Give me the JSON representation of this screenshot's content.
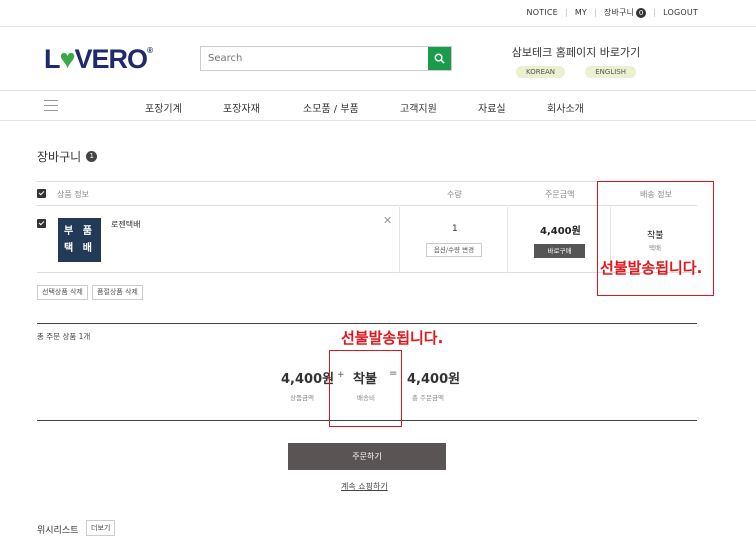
{
  "topbar": {
    "notice": "NOTICE",
    "my": "MY",
    "cart": "장바구니",
    "cart_count": "0",
    "logout": "LOGOUT"
  },
  "header": {
    "logo_l": "L",
    "logo_heart": "♥",
    "logo_rest": "VERO",
    "logo_reg": "®",
    "search_placeholder": "Search",
    "samboh_title": "삼보테크 홈페이지 바로가기",
    "lang_korean": "KOREAN",
    "lang_english": "ENGLISH"
  },
  "nav": [
    "포장기계",
    "포장자재",
    "소모품 / 부품",
    "고객지원",
    "자료실",
    "회사소개"
  ],
  "cart": {
    "title": "장바구니",
    "count": "1"
  },
  "table": {
    "headers": {
      "product": "상품 정보",
      "qty": "수량",
      "amount": "주문금액",
      "shipping": "배송 정보"
    },
    "item": {
      "thumb_line1": "부 품",
      "thumb_line2": "택 배",
      "name": "로젠택배",
      "qty": "1",
      "option_button": "옵션/수량 변경",
      "price": "4,400원",
      "buy_button": "바로구매",
      "shipping": "착불",
      "shipping_method": "택배"
    }
  },
  "actions": {
    "delete_selected": "선택상품 삭제",
    "delete_soldout": "품절상품 삭제"
  },
  "summary": {
    "count_label": "총 주문 상품 1개",
    "product_value": "4,400원",
    "product_label": "상품금액",
    "plus": "+",
    "shipping_value": "착불",
    "shipping_label": "배송비",
    "equals": "=",
    "total_value": "4,400원",
    "total_label": "총 주문금액"
  },
  "order_button": "주문하기",
  "continue_link": "계속 쇼핑하기",
  "wishlist": {
    "label": "위시리스트",
    "more": "더보기"
  },
  "annotations": {
    "text1": "선불발송됩니다.",
    "text2": "선불발송됩니다.",
    "color": "#e0161b"
  },
  "icons": {
    "search": "search-icon",
    "close": "close-icon",
    "menu": "hamburger-menu-icon"
  }
}
